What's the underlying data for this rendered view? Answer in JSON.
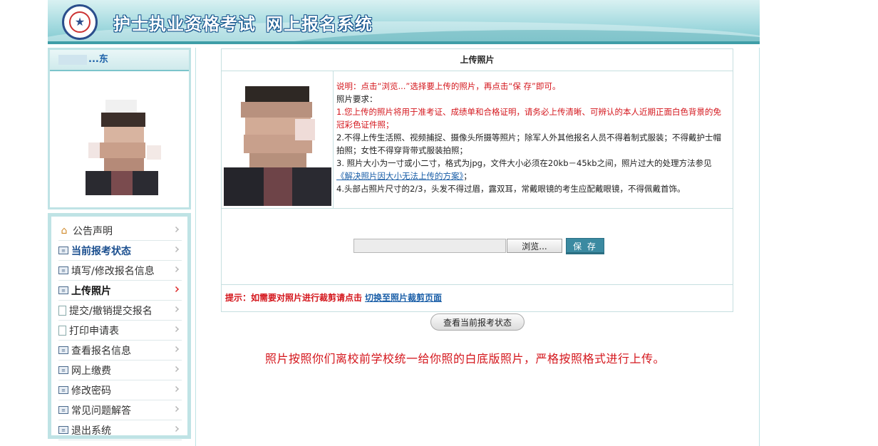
{
  "header": {
    "title_part1": "护士执业资格考试",
    "title_part2": "网上报名系统",
    "logo_icon": "exam-seal-icon"
  },
  "user": {
    "name_visible": "...东"
  },
  "nav": {
    "items": [
      {
        "label": "公告声明",
        "icon": "home-icon"
      },
      {
        "label": "当前报考状态",
        "icon": "form-icon"
      },
      {
        "label": "填写/修改报名信息",
        "icon": "form-icon"
      },
      {
        "label": "上传照片",
        "icon": "form-icon"
      },
      {
        "label": "提交/撤销提交报名",
        "icon": "document-icon"
      },
      {
        "label": "打印申请表",
        "icon": "document-icon"
      },
      {
        "label": "查看报名信息",
        "icon": "form-icon"
      },
      {
        "label": "网上缴费",
        "icon": "form-icon"
      },
      {
        "label": "修改密码",
        "icon": "form-icon"
      },
      {
        "label": "常见问题解答",
        "icon": "form-icon"
      },
      {
        "label": "退出系统",
        "icon": "form-icon"
      }
    ],
    "active_label": "上传照片"
  },
  "upload": {
    "heading": "上传照片",
    "instruction": "说明：点击“浏览...”选择要上传的照片，再点击“保 存”即可。",
    "req_title": "照片要求：",
    "req1": "1.您上传的照片将用于准考证、成绩单和合格证明，请务必上传清晰、可辨认的本人近期正面白色背景的免冠彩色证件照；",
    "req2": "2.不得上传生活照、视频捕捉、摄像头所摄等照片；除军人外其他报名人员不得着制式服装；不得戴护士帽拍照；女性不得穿背带式服装拍照；",
    "req3": "3. 照片大小为一寸或小二寸，格式为jpg，文件大小必须在20kb－45kb之间，照片过大的处理方法参见",
    "req3_link": "《解决照片因大小无法上传的方案》",
    "req3_tail": "；",
    "req4": "4.头部占照片尺寸的2/3，头发不得过眉，露双耳，常戴眼镜的考生应配戴眼镜，不得佩戴首饰。",
    "file_value": "",
    "browse_label": "浏览...",
    "save_label": "保 存",
    "crop_tip": "提示：如需要对照片进行裁剪请点击",
    "crop_link": "切换至照片裁剪页面"
  },
  "status_button": "查看当前报考状态",
  "notice": "照片按照你们离校前学校统一给你照的白底版照片，严格按照格式进行上传。",
  "colors": {
    "accent": "#3b8aa1",
    "warning_red": "#d4161c",
    "link_blue": "#1b5fa8",
    "panel_border": "#bfe3e5"
  }
}
